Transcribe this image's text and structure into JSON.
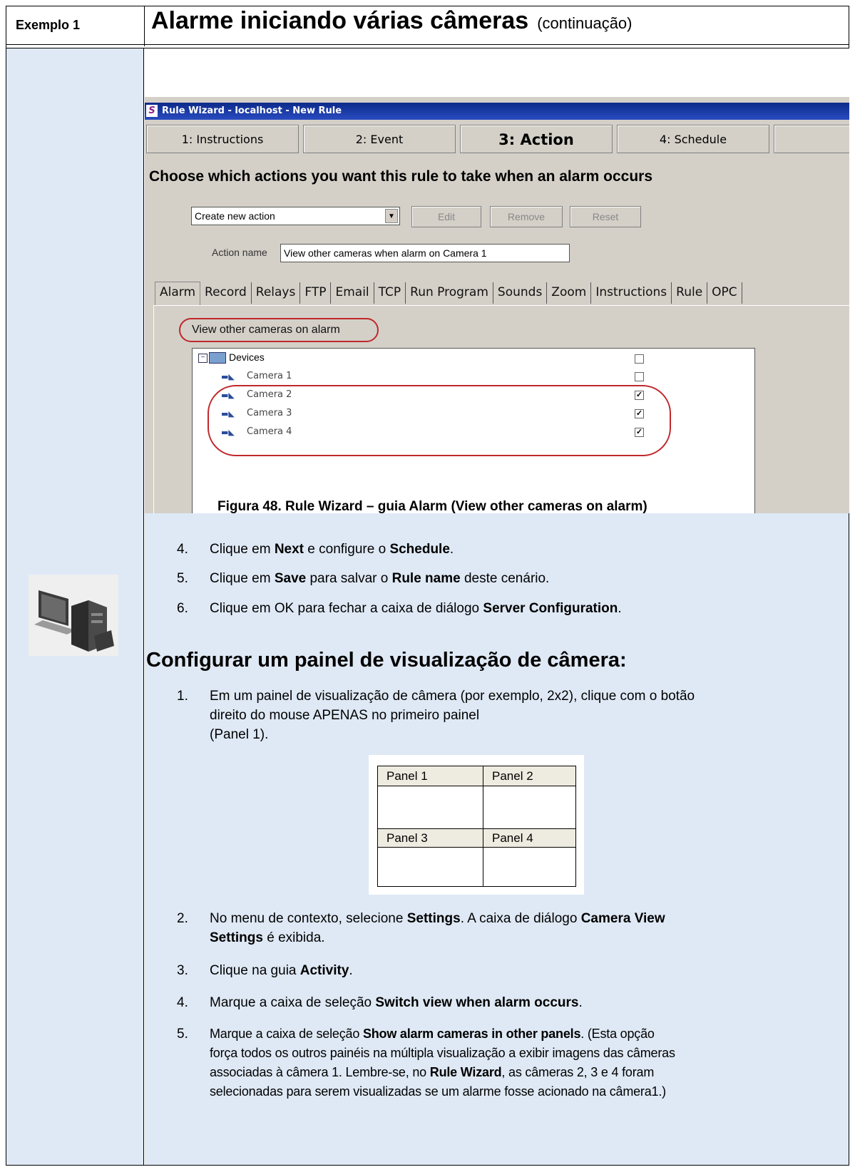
{
  "header": {
    "example_label": "Exemplo 1",
    "title": "Alarme iniciando várias câmeras",
    "continuation": "(continuação)"
  },
  "screenshot": {
    "window_title": "Rule Wizard - localhost - New Rule",
    "logo_letter": "S",
    "wizard_tabs": [
      "1: Instructions",
      "2: Event",
      "3: Action",
      "4: Schedule"
    ],
    "active_wizard_tab": "3: Action",
    "heading": "Choose which actions you want this rule to take when an alarm occurs",
    "action_select": "Create new action",
    "buttons": {
      "edit": "Edit",
      "remove": "Remove",
      "reset": "Reset"
    },
    "action_name_label": "Action name",
    "action_name_value": "View other cameras when alarm on Camera 1",
    "action_tabs": [
      "Alarm",
      "Record",
      "Relays",
      "FTP",
      "Email",
      "TCP",
      "Run Program",
      "Sounds",
      "Zoom",
      "Instructions",
      "Rule",
      "OPC"
    ],
    "active_action_tab": "Alarm",
    "option_label": "View other cameras on alarm",
    "tree_root": "Devices",
    "cameras": [
      {
        "name": "Camera 1",
        "checked": false
      },
      {
        "name": "Camera 2",
        "checked": true
      },
      {
        "name": "Camera 3",
        "checked": true
      },
      {
        "name": "Camera 4",
        "checked": true
      }
    ],
    "highlight_color": "#c0282b"
  },
  "caption": "Figura 48. Rule Wizard – guia Alarm (View other cameras on alarm)",
  "steps_a": [
    {
      "num": "4.",
      "p1": "Clique em ",
      "b1": "Next",
      "p2": " e configure o ",
      "b2": "Schedule",
      "p3": "."
    },
    {
      "num": "5.",
      "p1": "Clique em ",
      "b1": "Save",
      "p2": " para salvar o ",
      "b2": "Rule name",
      "p3": " deste cenário."
    },
    {
      "num": "6.",
      "p1": "Clique em OK para fechar a caixa de diálogo ",
      "b1": "Server Configuration",
      "p2": "."
    }
  ],
  "section_title": "Configurar um painel de visualização de câmera:",
  "steps_b": [
    {
      "num": "1.",
      "line1": "Em um painel de visualização de câmera (por exemplo, 2x2), clique com o botão",
      "line2": "direito do mouse APENAS no primeiro painel",
      "line3": "(Panel 1)."
    },
    {
      "num": "2.",
      "p1": "No menu de contexto, selecione ",
      "b1": "Settings",
      "p2": ". A caixa de diálogo ",
      "b2": "Camera View",
      "b3": "Settings",
      "p3": " é exibida."
    },
    {
      "num": "3.",
      "p1": "Clique na guia ",
      "b1": "Activity",
      "p2": "."
    },
    {
      "num": "4.",
      "p1": "Marque a caixa de seleção ",
      "b1": "Switch view when alarm occurs",
      "p2": "."
    },
    {
      "num": "5.",
      "p1": "Marque a caixa de seleção ",
      "b1": "Show alarm cameras in other panels",
      "p2": ". (Esta opção",
      "line2": "força todos os outros painéis na múltipla visualização a exibir imagens das câmeras",
      "line3": "associadas à câmera 1. Lembre-se, no ",
      "b2": "Rule Wizard",
      "p3": ", as câmeras 2, 3 e 4 foram",
      "line4": "selecionadas para serem visualizadas se um alarme fosse acionado na câmera1.)"
    }
  ],
  "panels": [
    "Panel 1",
    "Panel 2",
    "Panel 3",
    "Panel 4"
  ]
}
